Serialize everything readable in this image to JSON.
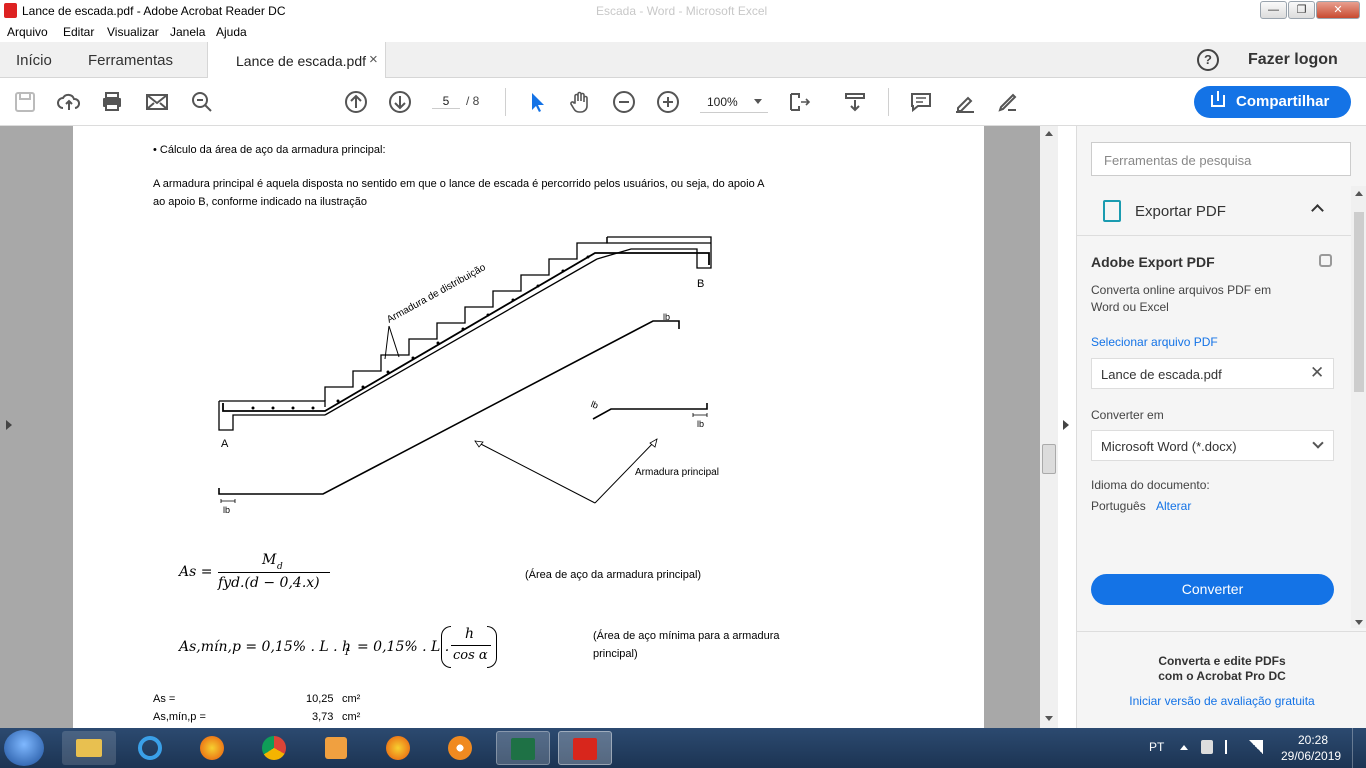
{
  "window": {
    "title": "Lance de escada.pdf - Adobe Acrobat Reader DC",
    "ghost_title": "Escada - Word - Microsoft Excel",
    "minimize": "—",
    "maximize": "❐",
    "close": "✕"
  },
  "menu": [
    "Arquivo",
    "Editar",
    "Visualizar",
    "Janela",
    "Ajuda"
  ],
  "tabs": {
    "home": "Início",
    "tools": "Ferramentas",
    "document": "Lance de escada.pdf",
    "document_close": "×",
    "help": "?",
    "login": "Fazer logon"
  },
  "toolbar": {
    "page_current": "5",
    "page_total": "/ 8",
    "zoom": "100%",
    "share": "Compartilhar"
  },
  "document": {
    "bullet_heading": "• Cálculo da área de aço da armadura principal:",
    "paragraph_line1": "A armadura principal é aquela disposta no sentido em que o lance de escada é percorrido pelos usuários, ou seja, do apoio A",
    "paragraph_line2": "ao apoio B, conforme indicado na ilustração",
    "figure": {
      "label_distribution": "Armadura de distribuição",
      "label_principal": "Armadura principal",
      "label_a": "A",
      "label_b": "B",
      "label_lb": "lb"
    },
    "formula1": {
      "lhs": "As =",
      "numerator": "M",
      "numerator_sub": "d",
      "denominator": "fyd.(d − 0,4.x)",
      "caption": "(Área de aço da armadura principal)"
    },
    "formula2": {
      "expression": "As,mín,p = 0,15% . L . h",
      "sub": "1",
      "middle": "= 0,15% . L .",
      "frac_num": "h",
      "frac_den": "cos α",
      "caption_line1": "(Área de aço mínima para a armadura",
      "caption_line2": "principal)"
    },
    "results": [
      {
        "label": "As =",
        "value": "10,25",
        "unit": "cm²"
      },
      {
        "label": "As,mín,p =",
        "value": "3,73",
        "unit": "cm²"
      }
    ]
  },
  "right_panel": {
    "search_placeholder": "Ferramentas de pesquisa",
    "export_title": "Exportar PDF",
    "service_title": "Adobe Export PDF",
    "service_desc_line1": "Converta online arquivos PDF em",
    "service_desc_line2": "Word ou Excel",
    "select_file": "Selecionar arquivo PDF",
    "selected_file": "Lance de escada.pdf",
    "convert_to_label": "Converter em",
    "convert_to_value": "Microsoft Word (*.docx)",
    "language_label": "Idioma do documento:",
    "language_value": "Português",
    "language_change": "Alterar",
    "convert_button": "Converter",
    "promo_line1": "Converta e edite PDFs",
    "promo_line2": "com o Acrobat Pro DC",
    "trial_link": "Iniciar versão de avaliação gratuita"
  },
  "taskbar": {
    "language": "PT",
    "time": "20:28",
    "date": "29/06/2019"
  },
  "colors": {
    "accent": "#1473e6",
    "taskbar": "#1c3453",
    "viewer_bg": "#a8a8a8"
  }
}
